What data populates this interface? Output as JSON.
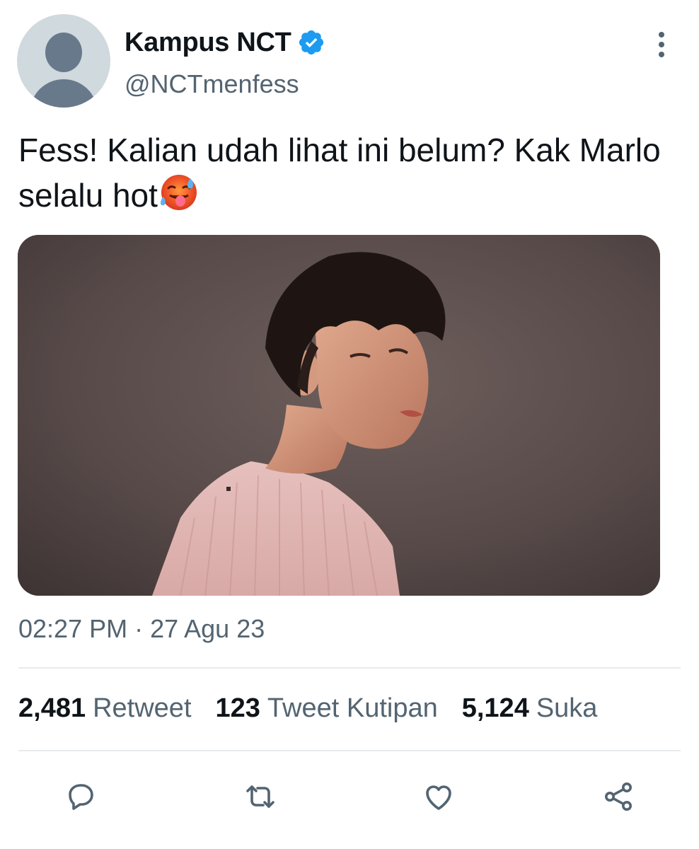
{
  "author": {
    "display_name": "Kampus NCT",
    "handle": "@NCTmenfess",
    "verified": true
  },
  "tweet": {
    "text": "Fess! Kalian udah lihat ini belum? Kak Marlo selalu hot",
    "emoji": "hot-face-emoji",
    "media": "photo"
  },
  "meta": {
    "time": "02:27 PM",
    "separator": " · ",
    "date": "27 Agu 23"
  },
  "stats": {
    "retweets": {
      "count": "2,481",
      "label": "Retweet"
    },
    "quotes": {
      "count": "123",
      "label": "Tweet Kutipan"
    },
    "likes": {
      "count": "5,124",
      "label": "Suka"
    }
  },
  "actions": [
    "reply-icon",
    "retweet-icon",
    "like-icon",
    "share-icon"
  ],
  "colors": {
    "text_primary": "#0f1419",
    "text_secondary": "#536471",
    "verified_blue": "#1d9bf0",
    "divider": "#e7ebee"
  }
}
